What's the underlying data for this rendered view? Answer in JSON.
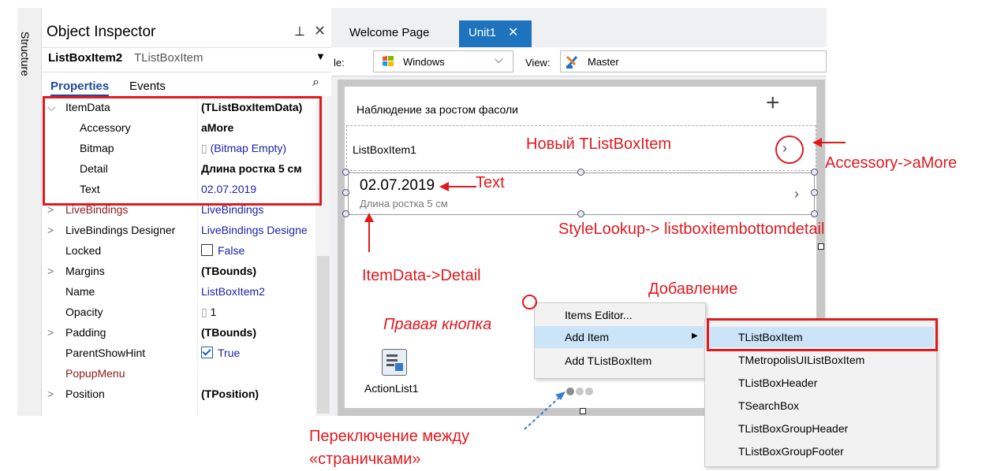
{
  "structure_panel": {
    "label": "Structure"
  },
  "object_inspector": {
    "title": "Object Inspector",
    "pin_icon": "pin-icon",
    "close_icon": "close-icon",
    "selected_object": {
      "name": "ListBoxItem2",
      "type": "TListBoxItem"
    },
    "tabs": [
      "Properties",
      "Events"
    ],
    "properties": [
      {
        "name": "ItemData",
        "value": "(TListBoxItemData)",
        "expander": "⌵",
        "name_style": "",
        "value_style": "bold"
      },
      {
        "name": "Accessory",
        "value": "aMore",
        "expander": "",
        "name_style": "",
        "value_style": "bold"
      },
      {
        "name": "Bitmap",
        "value": "(Bitmap Empty)",
        "expander": "",
        "name_style": "",
        "value_style": "blue"
      },
      {
        "name": "Detail",
        "value": "Длина ростка 5 см",
        "expander": "",
        "name_style": "",
        "value_style": "bold"
      },
      {
        "name": "Text",
        "value": "02.07.2019",
        "expander": "",
        "name_style": "",
        "value_style": "blue"
      },
      {
        "name": "LiveBindings",
        "value": "LiveBindings",
        "expander": ">",
        "name_style": "maroon",
        "value_style": "blue"
      },
      {
        "name": "LiveBindings Designer",
        "value": "LiveBindings Designe",
        "expander": ">",
        "name_style": "",
        "value_style": "blue"
      },
      {
        "name": "Locked",
        "value": "False",
        "expander": "",
        "name_style": "",
        "value_style": "blue"
      },
      {
        "name": "Margins",
        "value": "(TBounds)",
        "expander": ">",
        "name_style": "",
        "value_style": "bold"
      },
      {
        "name": "Name",
        "value": "ListBoxItem2",
        "expander": "",
        "name_style": "",
        "value_style": "blue"
      },
      {
        "name": "Opacity",
        "value": "1",
        "expander": "",
        "name_style": "",
        "value_style": ""
      },
      {
        "name": "Padding",
        "value": "(TBounds)",
        "expander": ">",
        "name_style": "",
        "value_style": "bold"
      },
      {
        "name": "ParentShowHint",
        "value": "True",
        "expander": "",
        "name_style": "",
        "value_style": "blue"
      },
      {
        "name": "PopupMenu",
        "value": "",
        "expander": "",
        "name_style": "maroon",
        "value_style": ""
      },
      {
        "name": "Position",
        "value": "(TPosition)",
        "expander": ">",
        "name_style": "",
        "value_style": "bold"
      }
    ],
    "search_icon": "search-icon"
  },
  "editor_tabs": [
    {
      "label": "Welcome Page",
      "active": false
    },
    {
      "label": "Unit1",
      "active": true
    }
  ],
  "designer_toolbar": {
    "style_label": "le:",
    "style_value": "Windows",
    "view_label": "View:",
    "view_value": "Master"
  },
  "form": {
    "listbox_header": "Наблюдение за ростом фасоли",
    "item1_text": "ListBoxItem1",
    "item2_text": "02.07.2019",
    "item2_detail": "Длина ростка 5 см",
    "actionlist_label": "ActionList1",
    "page_count": 3
  },
  "context_menu": {
    "items": [
      "Items Editor...",
      "Add Item",
      "Add TListBoxItem"
    ],
    "submenu": [
      "TListBoxItem",
      "TMetropolisUIListBoxItem",
      "TListBoxHeader",
      "TSearchBox",
      "TListBoxGroupHeader",
      "TListBoxGroupFooter"
    ]
  },
  "annotations": {
    "new_item": "Новый TListBoxItem",
    "accessory": "Accessory->aMore",
    "text": "Text",
    "stylelookup": "StyleLookup->   listboxitembottomdetail",
    "itemdata_detail": "ItemData->Detail",
    "adding": "Добавление",
    "right_button": "Правая кнопка",
    "page_switch_1": "Переключение между",
    "page_switch_2": "«страничками»"
  },
  "colors": {
    "annotation_red": "#e0191f",
    "tab_active": "#1e73be",
    "menu_highlight": "#cce4f7"
  }
}
